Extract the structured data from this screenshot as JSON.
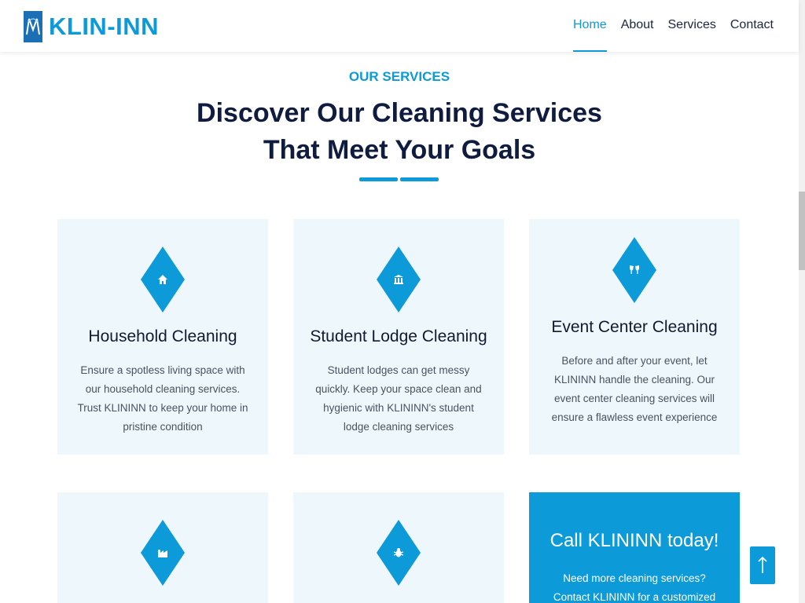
{
  "header": {
    "logo_text": "KLIN-INN",
    "nav": [
      {
        "label": "Home",
        "active": true
      },
      {
        "label": "About",
        "active": false
      },
      {
        "label": "Services",
        "active": false
      },
      {
        "label": "Contact",
        "active": false
      }
    ]
  },
  "section": {
    "eyebrow": "OUR SERVICES",
    "heading_line1": "Discover Our Cleaning Services",
    "heading_line2": "That Meet Your Goals"
  },
  "cards": [
    {
      "icon": "home-icon",
      "title": "Household Cleaning",
      "description": "Ensure a spotless living space with our household cleaning services. Trust KLININN to keep your home in pristine condition"
    },
    {
      "icon": "building-icon",
      "title": "Student Lodge Cleaning",
      "description": "Student lodges can get messy quickly. Keep your space clean and hygienic with KLININN's student lodge cleaning services"
    },
    {
      "icon": "glasses-toast-icon",
      "title": "Event Center Cleaning",
      "description": "Before and after your event, let KLININN handle the cleaning. Our event center cleaning services will ensure a flawless event experience"
    },
    {
      "icon": "industry-icon",
      "title": "",
      "description": ""
    },
    {
      "icon": "bug-icon",
      "title": "",
      "description": ""
    }
  ],
  "cta": {
    "title": "Call KLININN today!",
    "description": "Need more cleaning services? Contact KLININN for a customized solution."
  },
  "colors": {
    "accent": "#0d9ad8",
    "heading": "#0f1c3f",
    "card_bg": "#eef7fc"
  },
  "back_to_top_icon": "arrow-up-icon"
}
